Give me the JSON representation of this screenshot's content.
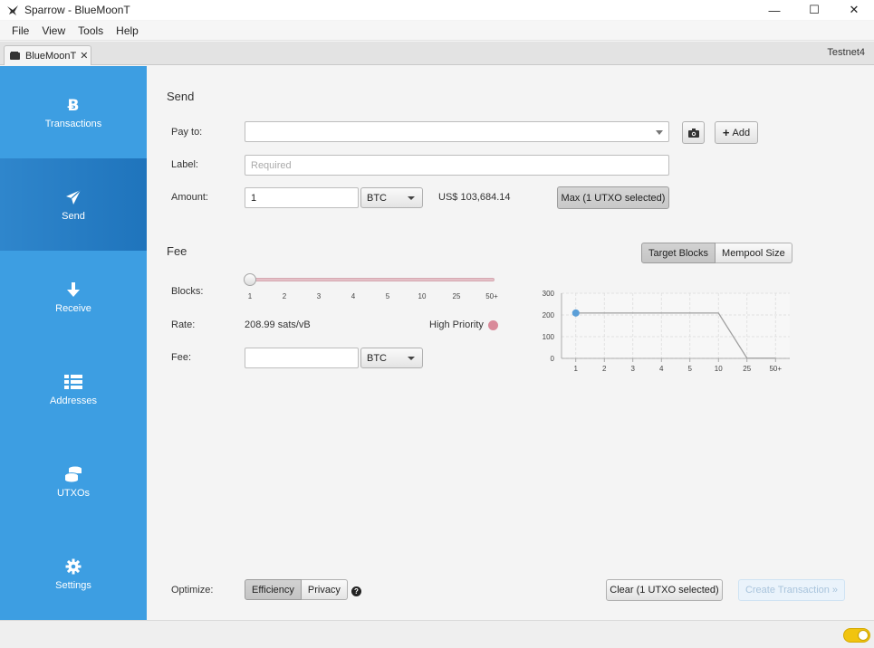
{
  "window": {
    "title": "Sparrow - BlueMoonT",
    "minimize": "—",
    "maximize": "☐",
    "close": "✕"
  },
  "menu": {
    "items": [
      "File",
      "View",
      "Tools",
      "Help"
    ]
  },
  "tab": {
    "label": "BlueMoonT",
    "close": "✕",
    "network": "Testnet4"
  },
  "sidebar": {
    "items": [
      {
        "label": "Transactions",
        "icon": "bitcoin-icon"
      },
      {
        "label": "Send",
        "icon": "paper-plane-icon"
      },
      {
        "label": "Receive",
        "icon": "arrow-down-icon"
      },
      {
        "label": "Addresses",
        "icon": "list-icon"
      },
      {
        "label": "UTXOs",
        "icon": "coins-icon"
      },
      {
        "label": "Settings",
        "icon": "gear-icon"
      }
    ],
    "active": "Send"
  },
  "send": {
    "title": "Send",
    "pay_to_label": "Pay to:",
    "pay_to_value": "",
    "add_label": "Add",
    "label_label": "Label:",
    "label_placeholder": "Required",
    "amount_label": "Amount:",
    "amount_value": "1",
    "amount_unit": "BTC",
    "fiat_value": "US$ 103,684.14",
    "max_label": "Max (1 UTXO selected)"
  },
  "fee": {
    "title": "Fee",
    "target_blocks_label": "Target Blocks",
    "mempool_size_label": "Mempool Size",
    "blocks_label": "Blocks:",
    "ticks": [
      "1",
      "2",
      "3",
      "4",
      "5",
      "10",
      "25",
      "50+"
    ],
    "slider_position": 0,
    "rate_label": "Rate:",
    "rate_value": "208.99 sats/vB",
    "priority_label": "High Priority",
    "fee_label": "Fee:",
    "fee_value": "",
    "fee_unit": "BTC"
  },
  "chart_data": {
    "type": "line",
    "categories": [
      "1",
      "2",
      "3",
      "4",
      "5",
      "10",
      "25",
      "50+"
    ],
    "series": [
      {
        "values": [
          208.99,
          208.99,
          208.99,
          208.99,
          208.99,
          208.99,
          1,
          1
        ]
      }
    ],
    "highlight_index": 0,
    "y_ticks": [
      "0",
      "100",
      "200",
      "300"
    ],
    "ylim": [
      0,
      300
    ],
    "grid": true,
    "colors": {
      "line": "#a0a0a0",
      "highlight": "#5b9fd8",
      "grid": "#dcdcdc"
    }
  },
  "footer": {
    "optimize_label": "Optimize:",
    "efficiency_label": "Efficiency",
    "privacy_label": "Privacy",
    "help_glyph": "?",
    "clear_label": "Clear (1 UTXO selected)",
    "create_label": "Create Transaction »"
  },
  "colors": {
    "sidebar": "#3d9ee2",
    "sidebar_active": "#2c82c8",
    "priority": "#d98a9a",
    "toggle": "#f1c40f"
  }
}
